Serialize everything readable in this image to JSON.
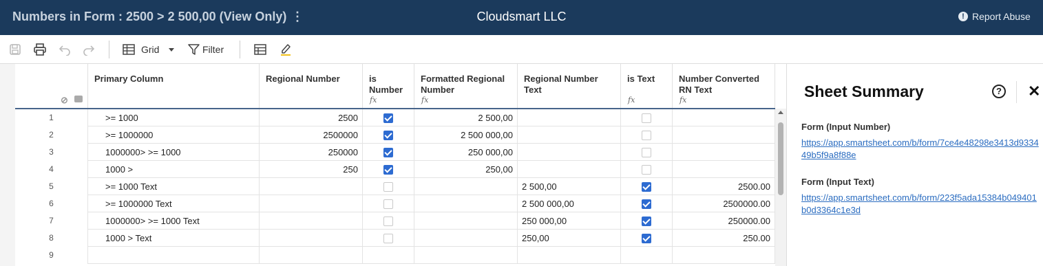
{
  "header": {
    "title": "Numbers in Form : 2500 > 2 500,00 (View Only)",
    "menu_glyph": "⋮",
    "company": "Cloudsmart LLC",
    "report_label": "Report Abuse",
    "report_icon_glyph": "!"
  },
  "toolbar": {
    "grid_label": "Grid",
    "filter_label": "Filter"
  },
  "columns": [
    {
      "label": "Primary Column",
      "formula": ""
    },
    {
      "label": "Regional Number",
      "formula": ""
    },
    {
      "label": "is Number",
      "formula": "fx"
    },
    {
      "label": "Formatted Regional Number",
      "formula": "fx"
    },
    {
      "label": "Regional Number Text",
      "formula": ""
    },
    {
      "label": "is Text",
      "formula": "fx"
    },
    {
      "label": "Number Converted RN Text",
      "formula": "fx"
    }
  ],
  "rows": [
    {
      "num": "1",
      "primary": ">= 1000",
      "regional": "2500",
      "is_number": true,
      "formatted": "2 500,00",
      "rn_text": "",
      "is_text": false,
      "converted": ""
    },
    {
      "num": "2",
      "primary": ">= 1000000",
      "regional": "2500000",
      "is_number": true,
      "formatted": "2 500 000,00",
      "rn_text": "",
      "is_text": false,
      "converted": ""
    },
    {
      "num": "3",
      "primary": "1000000> >= 1000",
      "regional": "250000",
      "is_number": true,
      "formatted": "250 000,00",
      "rn_text": "",
      "is_text": false,
      "converted": ""
    },
    {
      "num": "4",
      "primary": "1000 >",
      "regional": "250",
      "is_number": true,
      "formatted": "250,00",
      "rn_text": "",
      "is_text": false,
      "converted": ""
    },
    {
      "num": "5",
      "primary": ">= 1000 Text",
      "regional": "",
      "is_number": false,
      "formatted": "",
      "rn_text": "2 500,00",
      "is_text": true,
      "converted": "2500.00"
    },
    {
      "num": "6",
      "primary": ">= 1000000 Text",
      "regional": "",
      "is_number": false,
      "formatted": "",
      "rn_text": "2 500 000,00",
      "is_text": true,
      "converted": "2500000.00"
    },
    {
      "num": "7",
      "primary": "1000000> >= 1000 Text",
      "regional": "",
      "is_number": false,
      "formatted": "",
      "rn_text": "250 000,00",
      "is_text": true,
      "converted": "250000.00"
    },
    {
      "num": "8",
      "primary": "1000 > Text",
      "regional": "",
      "is_number": false,
      "formatted": "",
      "rn_text": "250,00",
      "is_text": true,
      "converted": "250.00"
    },
    {
      "num": "9",
      "primary": "",
      "regional": "",
      "is_number": null,
      "formatted": "",
      "rn_text": "",
      "is_text": null,
      "converted": ""
    }
  ],
  "panel": {
    "title": "Sheet Summary",
    "help_glyph": "?",
    "close_glyph": "✕",
    "fields": [
      {
        "label": "Form (Input Number)",
        "link": "https://app.smartsheet.com/b/form/7ce4e48298e3413d933449b5f9a8f88e"
      },
      {
        "label": "Form (Input Text)",
        "link": "https://app.smartsheet.com/b/form/223f5ada15384b049401b0d3364c1e3d"
      }
    ]
  },
  "colors": {
    "header_bg": "#1b3a5c",
    "checkbox_on": "#2d6bd1",
    "link": "#2a6cc0"
  }
}
